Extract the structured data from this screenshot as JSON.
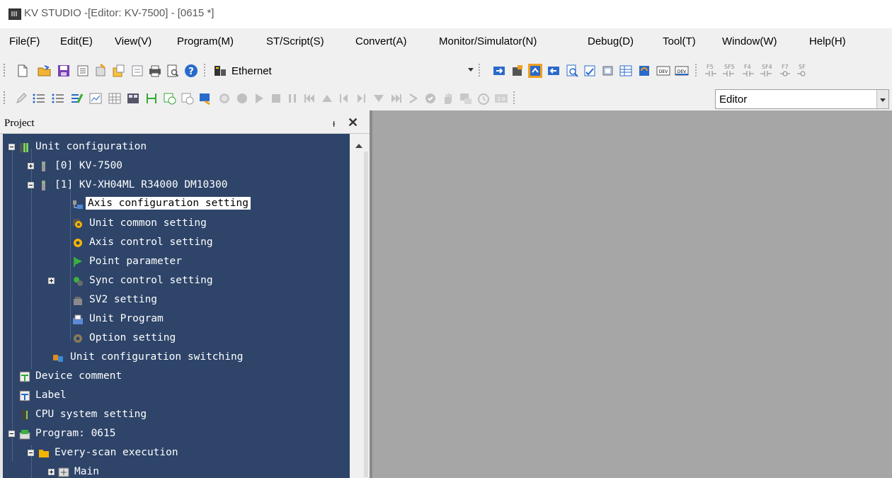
{
  "title_bar": {
    "title": "KV STUDIO -[Editor: KV-7500] - [0615 *]"
  },
  "menu": [
    "File(F)",
    "Edit(E)",
    "View(V)",
    "Program(M)",
    "ST/Script(S)",
    "Convert(A)",
    "Monitor/Simulator(N)",
    "Debug(D)",
    "Tool(T)",
    "Window(W)",
    "Help(H)"
  ],
  "toolbar1": {
    "connection": "Ethernet",
    "icons": [
      "new-icon",
      "open-icon",
      "save-icon",
      "save-all-icon",
      "import-icon",
      "export-icon",
      "check-icon",
      "print-icon",
      "print-preview-icon",
      "help-icon",
      "transfer-icon",
      "monitor-icon",
      "simulator-icon",
      "read-icon",
      "verify-icon",
      "register-icon",
      "dev-icon",
      "dev-monitor-icon",
      "edit-icon"
    ],
    "fkeys": [
      "F5",
      "SF5",
      "F4",
      "SF4",
      "F7",
      "SF"
    ]
  },
  "toolbar2": {
    "mode": "Editor"
  },
  "project_pane": {
    "title": "Project",
    "pin": "ᵼ",
    "close": "✕"
  },
  "tree": [
    {
      "label": "Unit configuration",
      "level": 0,
      "icon": "unit-config-icon",
      "expander": "minus",
      "selected": false
    },
    {
      "label": "[0]  KV-7500",
      "level": 1,
      "icon": "unit-icon",
      "expander": "plus",
      "selected": false
    },
    {
      "label": "[1]  KV-XH04ML   R34000  DM10300",
      "level": 1,
      "icon": "unit-icon",
      "expander": "minus",
      "selected": false
    },
    {
      "label": "Axis configuration setting",
      "level": 2,
      "icon": "axis-config-icon",
      "expander": "none",
      "selected": true
    },
    {
      "label": "Unit common setting",
      "level": 2,
      "icon": "gear-yellow-icon",
      "expander": "none",
      "selected": false
    },
    {
      "label": "Axis control setting",
      "level": 2,
      "icon": "gear-yellow-icon",
      "expander": "none",
      "selected": false
    },
    {
      "label": "Point parameter",
      "level": 2,
      "icon": "flag-icon",
      "expander": "none",
      "selected": false
    },
    {
      "label": "Sync control setting",
      "level": 2,
      "icon": "gear-green-icon",
      "expander": "plus",
      "selected": false
    },
    {
      "label": "SV2 setting",
      "level": 2,
      "icon": "sv2-icon",
      "expander": "none",
      "selected": false
    },
    {
      "label": "Unit Program",
      "level": 2,
      "icon": "program-unit-icon",
      "expander": "none",
      "selected": false
    },
    {
      "label": "Option setting",
      "level": 2,
      "icon": "gear-gray-icon",
      "expander": "none",
      "selected": false
    },
    {
      "label": "Unit configuration switching",
      "level": 1,
      "icon": "switch-icon",
      "expander": "none",
      "selected": false
    },
    {
      "label": "Device comment",
      "level": 0,
      "icon": "comment-icon",
      "expander": "none",
      "selected": false
    },
    {
      "label": "Label",
      "level": 0,
      "icon": "label-icon",
      "expander": "none",
      "selected": false
    },
    {
      "label": "CPU system setting",
      "level": 0,
      "icon": "cpu-icon",
      "expander": "none",
      "selected": false
    },
    {
      "label": "Program: 0615",
      "level": 0,
      "icon": "program-icon",
      "expander": "minus",
      "selected": false
    },
    {
      "label": "Every-scan execution",
      "level": 1,
      "icon": "folder-icon",
      "expander": "minus",
      "selected": false
    },
    {
      "label": "Main",
      "level": 2,
      "icon": "main-program-icon",
      "expander": "plus",
      "selected": false
    }
  ],
  "colors": {
    "tree_bg": "#2e4469",
    "editor_bg": "#a6a6a6",
    "selection_bg": "#ffffff"
  }
}
